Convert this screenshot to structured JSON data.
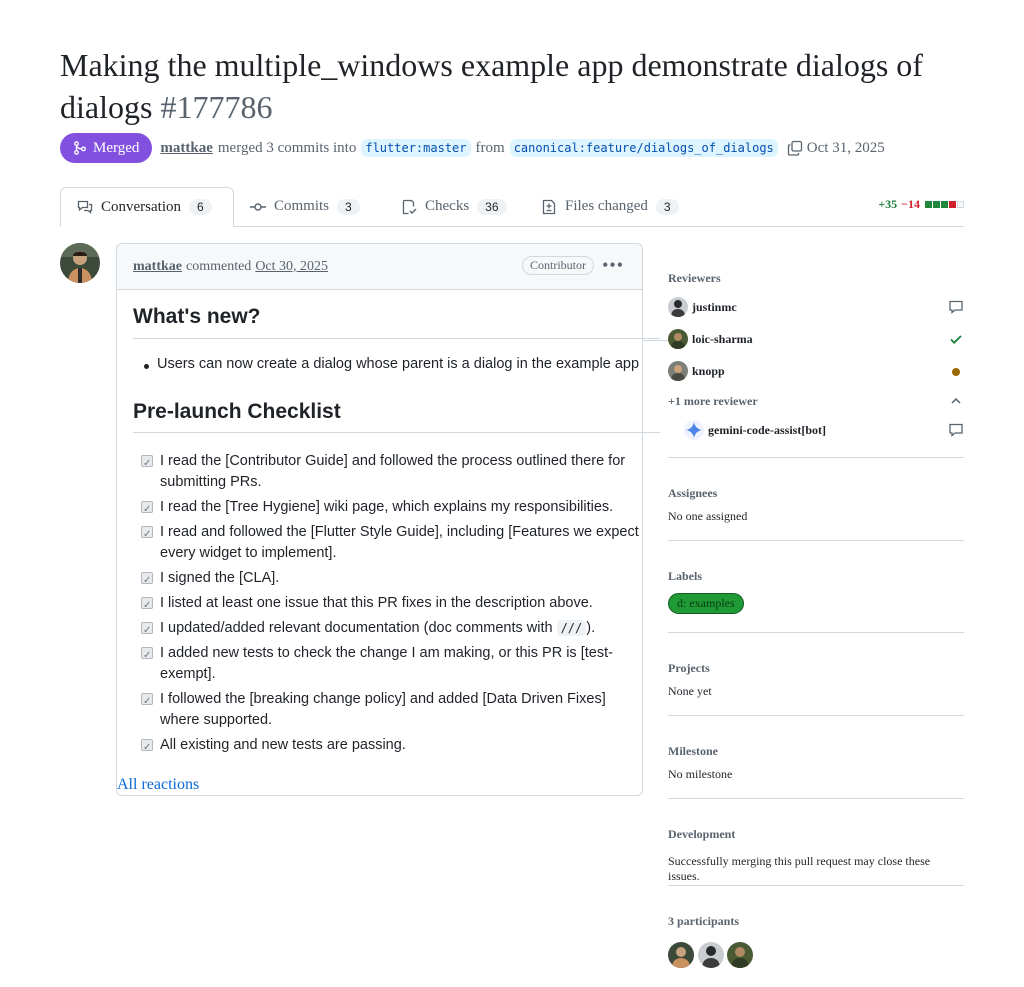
{
  "title": "Making the multiple_windows example app demonstrate dialogs of dialogs",
  "pr_number": "#177786",
  "meta": {
    "status": "Merged",
    "author": "mattkae",
    "action": "merged 3 commits into",
    "base_branch": "flutter:master",
    "from": "from",
    "head_branch": "canonical:feature/dialogs_of_dialogs",
    "date": "Oct 31, 2025"
  },
  "tabs": [
    {
      "label": "Conversation",
      "count": "6"
    },
    {
      "label": "Commits",
      "count": "3"
    },
    {
      "label": "Checks",
      "count": "36"
    },
    {
      "label": "Files changed",
      "count": "3"
    }
  ],
  "diffstat": {
    "additions": "+35",
    "deletions": "−14"
  },
  "comment": {
    "author": "mattkae",
    "verb": "commented",
    "date": "Oct 30, 2025",
    "role": "Contributor",
    "heading1": "What's new?",
    "bullet": "Users can now create a dialog whose parent is a dialog in the example app",
    "heading2": "Pre-launch Checklist",
    "checklist": [
      "I read the [Contributor Guide] and followed the process outlined there for submitting PRs.",
      "I read the [Tree Hygiene] wiki page, which explains my responsibilities.",
      "I read and followed the [Flutter Style Guide], including [Features we expect every widget to implement].",
      "I signed the [CLA].",
      "I listed at least one issue that this PR fixes in the description above.",
      "I updated/added relevant documentation (doc comments with",
      "I added new tests to check the change I am making, or this PR is [test-exempt].",
      "I followed the [breaking change policy] and added [Data Driven Fixes] where supported.",
      "All existing and new tests are passing."
    ],
    "doc_code": "///",
    "doc_suffix": ").",
    "reactions": "All reactions"
  },
  "sidebar": {
    "reviewers_title": "Reviewers",
    "reviewers": [
      {
        "name": "justinmc",
        "state": "comment"
      },
      {
        "name": "loic-sharma",
        "state": "approved"
      },
      {
        "name": "knopp",
        "state": "pending"
      }
    ],
    "more_reviewers": "+1 more reviewer",
    "bot_reviewer": "gemini-code-assist[bot]",
    "assignees_title": "Assignees",
    "assignees_value": "No one assigned",
    "labels_title": "Labels",
    "label": "d: examples",
    "projects_title": "Projects",
    "projects_value": "None yet",
    "milestone_title": "Milestone",
    "milestone_value": "No milestone",
    "development_title": "Development",
    "development_value": "Successfully merging this pull request may close these issues.",
    "participants_title": "3 participants"
  },
  "colors": {
    "merged": "#8250df",
    "approved": "#1a7f37",
    "pending": "#9a6700",
    "link": "#0969da"
  }
}
